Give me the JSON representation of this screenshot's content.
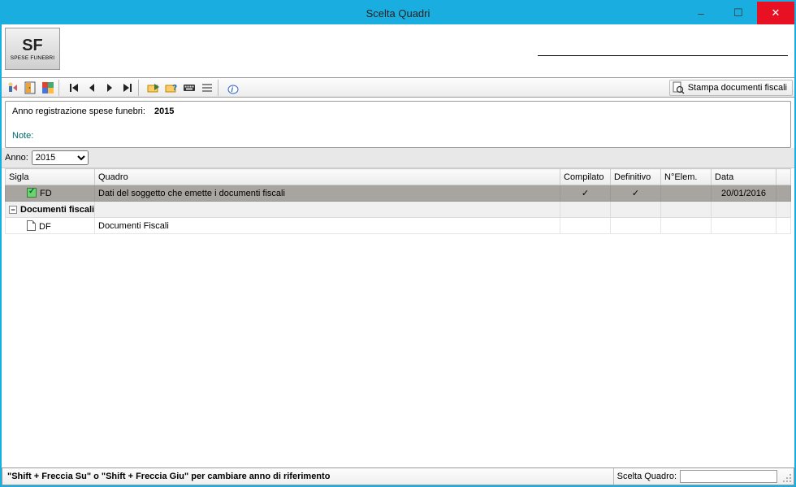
{
  "window": {
    "title": "Scelta Quadri"
  },
  "header": {
    "logo_big": "SF",
    "logo_small": "SPESE FUNEBRI"
  },
  "toolbar": {
    "stampa_label": "Stampa documenti fiscali"
  },
  "info": {
    "reg_label": "Anno registrazione spese funebri:",
    "reg_year": "2015",
    "note_label": "Note:"
  },
  "filter": {
    "anno_label": "Anno:",
    "anno_value": "2015",
    "anno_options": [
      "2015"
    ]
  },
  "columns": {
    "sigla": "Sigla",
    "quadro": "Quadro",
    "compilato": "Compilato",
    "definitivo": "Definitivo",
    "nelem": "N°Elem.",
    "data": "Data"
  },
  "rows": [
    {
      "kind": "data",
      "selected": true,
      "icon": "check",
      "sigla": "FD",
      "quadro": "Dati del soggetto che emette i documenti fiscali",
      "compilato": "✓",
      "definitivo": "✓",
      "nelem": "",
      "data": "20/01/2016"
    },
    {
      "kind": "group",
      "expanded": true,
      "label": "Documenti fiscali"
    },
    {
      "kind": "data",
      "selected": false,
      "icon": "doc",
      "sigla": "DF",
      "quadro": "Documenti Fiscali",
      "compilato": "",
      "definitivo": "",
      "nelem": "",
      "data": ""
    }
  ],
  "footer": {
    "hint": "\"Shift + Freccia Su\" o \"Shift + Freccia Giu\" per cambiare anno di riferimento",
    "scelta_label": "Scelta Quadro:",
    "scelta_value": ""
  }
}
